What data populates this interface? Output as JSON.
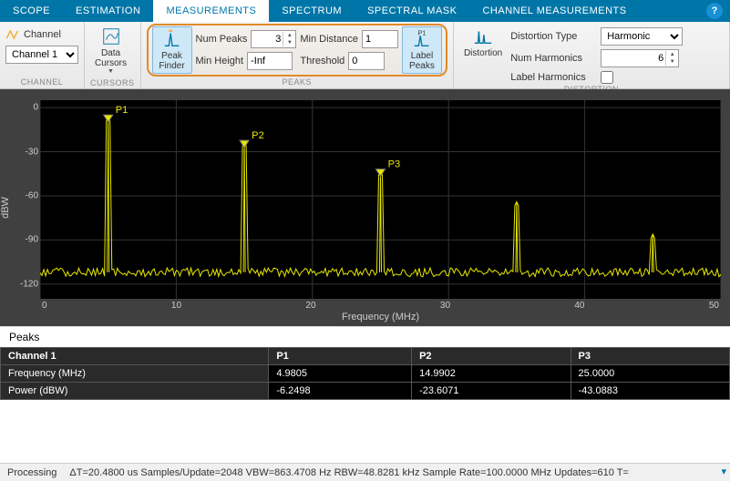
{
  "tabs": [
    "SCOPE",
    "ESTIMATION",
    "MEASUREMENTS",
    "SPECTRUM",
    "SPECTRAL MASK",
    "CHANNEL MEASUREMENTS"
  ],
  "active_tab": 2,
  "channel": {
    "label": "Channel",
    "value": "Channel 1",
    "group": "CHANNEL"
  },
  "cursors": {
    "btn": "Data\nCursors",
    "group": "CURSORS"
  },
  "peaks": {
    "finder": "Peak\nFinder",
    "num_peaks_label": "Num Peaks",
    "num_peaks": "3",
    "min_height_label": "Min Height",
    "min_height": "-Inf",
    "min_distance_label": "Min Distance",
    "min_distance": "1",
    "threshold_label": "Threshold",
    "threshold": "0",
    "label_btn": "Label\nPeaks",
    "group": "PEAKS"
  },
  "distortion": {
    "btn": "Distortion",
    "type_label": "Distortion Type",
    "type_value": "Harmonic",
    "num_label": "Num Harmonics",
    "num_value": "6",
    "label_chk": "Label Harmonics",
    "group": "DISTORTION"
  },
  "chart_data": {
    "type": "line",
    "xlabel": "Frequency (MHz)",
    "ylabel": "dBW",
    "xlim": [
      0,
      50
    ],
    "ylim": [
      -130,
      5
    ],
    "xticks": [
      "0",
      "10",
      "20",
      "30",
      "40",
      "50"
    ],
    "yticks": [
      "0",
      "-30",
      "-60",
      "-90",
      "-120"
    ],
    "noise_floor": -112,
    "peaks": [
      {
        "label": "P1",
        "x": 5,
        "y": -6.25
      },
      {
        "label": "P2",
        "x": 15,
        "y": -23.6
      },
      {
        "label": "P3",
        "x": 25,
        "y": -43.1
      },
      {
        "label": "",
        "x": 35,
        "y": -64
      },
      {
        "label": "",
        "x": 45,
        "y": -86
      }
    ]
  },
  "peaks_table": {
    "title": "Peaks",
    "headers": [
      "Channel 1",
      "P1",
      "P2",
      "P3"
    ],
    "rows": [
      {
        "label": "Frequency (MHz)",
        "vals": [
          "4.9805",
          "14.9902",
          "25.0000"
        ]
      },
      {
        "label": "Power (dBW)",
        "vals": [
          "-6.2498",
          "-23.6071",
          "-43.0883"
        ]
      }
    ]
  },
  "status": {
    "state": "Processing",
    "items": [
      "ΔT=20.4800 us",
      "Samples/Update=2048",
      "VBW=863.4708 Hz",
      "RBW=48.8281 kHz",
      "Sample Rate=100.0000 MHz",
      "Updates=610",
      "T="
    ]
  }
}
